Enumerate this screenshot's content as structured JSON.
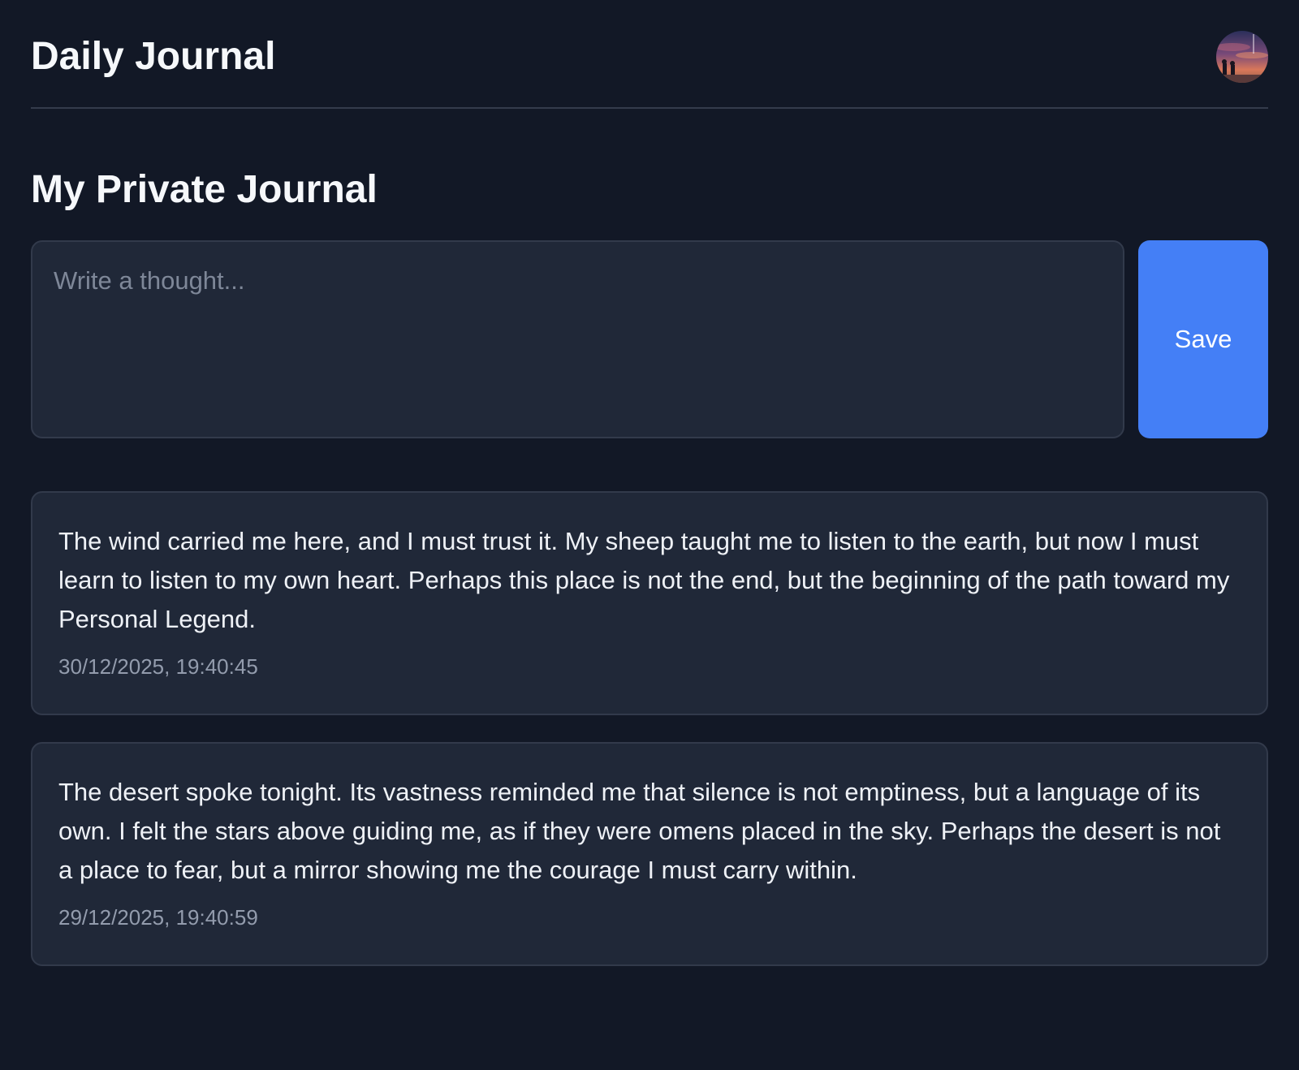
{
  "header": {
    "title": "Daily Journal",
    "avatar_icon": "user-avatar"
  },
  "main": {
    "section_title": "My Private Journal",
    "composer": {
      "placeholder": "Write a thought...",
      "value": "",
      "save_label": "Save"
    },
    "entries": [
      {
        "text": "The wind carried me here, and I must trust it. My sheep taught me to listen to the earth, but now I must learn to listen to my own heart. Perhaps this place is not the end, but the beginning of the path toward my Personal Legend.",
        "timestamp": "30/12/2025, 19:40:45"
      },
      {
        "text": "The desert spoke tonight. Its vastness reminded me that silence is not emptiness, but a language of its own. I felt the stars above guiding me, as if they were omens placed in the sky. Perhaps the desert is not a place to fear, but a mirror showing me the courage I must carry within.",
        "timestamp": "29/12/2025, 19:40:59"
      }
    ]
  },
  "colors": {
    "background": "#121826",
    "card": "#202838",
    "border": "#323a4b",
    "accent": "#447ff6",
    "muted_text": "#939cad"
  }
}
